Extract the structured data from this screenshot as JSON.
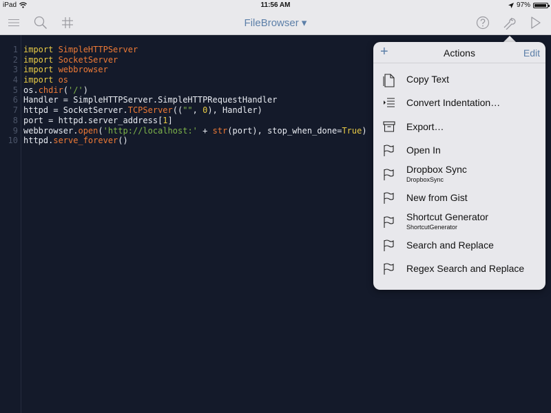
{
  "status_bar": {
    "device": "iPad",
    "time": "11:56 AM",
    "battery": "97%",
    "battery_level": 0.97
  },
  "toolbar": {
    "title": "FileBrowser ▾"
  },
  "editor": {
    "line_numbers": [
      "1",
      "2",
      "3",
      "4",
      "5",
      "6",
      "7",
      "8",
      "9",
      "10"
    ],
    "lines": [
      [
        {
          "t": "import ",
          "c": "kw"
        },
        {
          "t": "SimpleHTTPServer",
          "c": "mod"
        }
      ],
      [
        {
          "t": "import ",
          "c": "kw"
        },
        {
          "t": "SocketServer",
          "c": "mod"
        }
      ],
      [
        {
          "t": "import ",
          "c": "kw"
        },
        {
          "t": "webbrowser",
          "c": "mod"
        }
      ],
      [
        {
          "t": "import ",
          "c": "kw"
        },
        {
          "t": "os",
          "c": "mod"
        }
      ],
      [
        {
          "t": "os.",
          "c": ""
        },
        {
          "t": "chdir",
          "c": "fn"
        },
        {
          "t": "(",
          "c": ""
        },
        {
          "t": "'/'",
          "c": "str"
        },
        {
          "t": ")",
          "c": ""
        }
      ],
      [
        {
          "t": "Handler = SimpleHTTPServer.SimpleHTTPRequestHandler",
          "c": ""
        }
      ],
      [
        {
          "t": "httpd = SocketServer.",
          "c": ""
        },
        {
          "t": "TCPServer",
          "c": "fn"
        },
        {
          "t": "((",
          "c": ""
        },
        {
          "t": "\"\"",
          "c": "str"
        },
        {
          "t": ", ",
          "c": ""
        },
        {
          "t": "0",
          "c": "kw"
        },
        {
          "t": "), Handler)",
          "c": ""
        }
      ],
      [
        {
          "t": "port = httpd.server_address[",
          "c": ""
        },
        {
          "t": "1",
          "c": "kw"
        },
        {
          "t": "]",
          "c": ""
        }
      ],
      [
        {
          "t": "webbrowser.",
          "c": ""
        },
        {
          "t": "open",
          "c": "fn"
        },
        {
          "t": "(",
          "c": ""
        },
        {
          "t": "'http://localhost:'",
          "c": "str"
        },
        {
          "t": " + ",
          "c": ""
        },
        {
          "t": "str",
          "c": "fn"
        },
        {
          "t": "(port), stop_when_done=",
          "c": ""
        },
        {
          "t": "True",
          "c": "kw"
        },
        {
          "t": ")",
          "c": ""
        }
      ],
      [
        {
          "t": "httpd.",
          "c": ""
        },
        {
          "t": "serve_forever",
          "c": "fn"
        },
        {
          "t": "()",
          "c": ""
        }
      ]
    ]
  },
  "popover": {
    "title": "Actions",
    "add_symbol": "+",
    "edit_label": "Edit",
    "items": [
      {
        "label": "Copy Text",
        "icon": "document-icon"
      },
      {
        "label": "Convert Indentation…",
        "icon": "indent-icon"
      },
      {
        "label": "Export…",
        "icon": "archive-box-icon"
      },
      {
        "label": "Open In",
        "icon": "flag-icon"
      },
      {
        "label": "Dropbox Sync",
        "sub": "DropboxSync",
        "icon": "flag-icon"
      },
      {
        "label": "New from Gist",
        "icon": "flag-icon"
      },
      {
        "label": "Shortcut Generator",
        "sub": "ShortcutGenerator",
        "icon": "flag-icon"
      },
      {
        "label": "Search and Replace",
        "icon": "flag-icon"
      },
      {
        "label": "Regex Search and Replace",
        "icon": "flag-icon"
      }
    ]
  }
}
